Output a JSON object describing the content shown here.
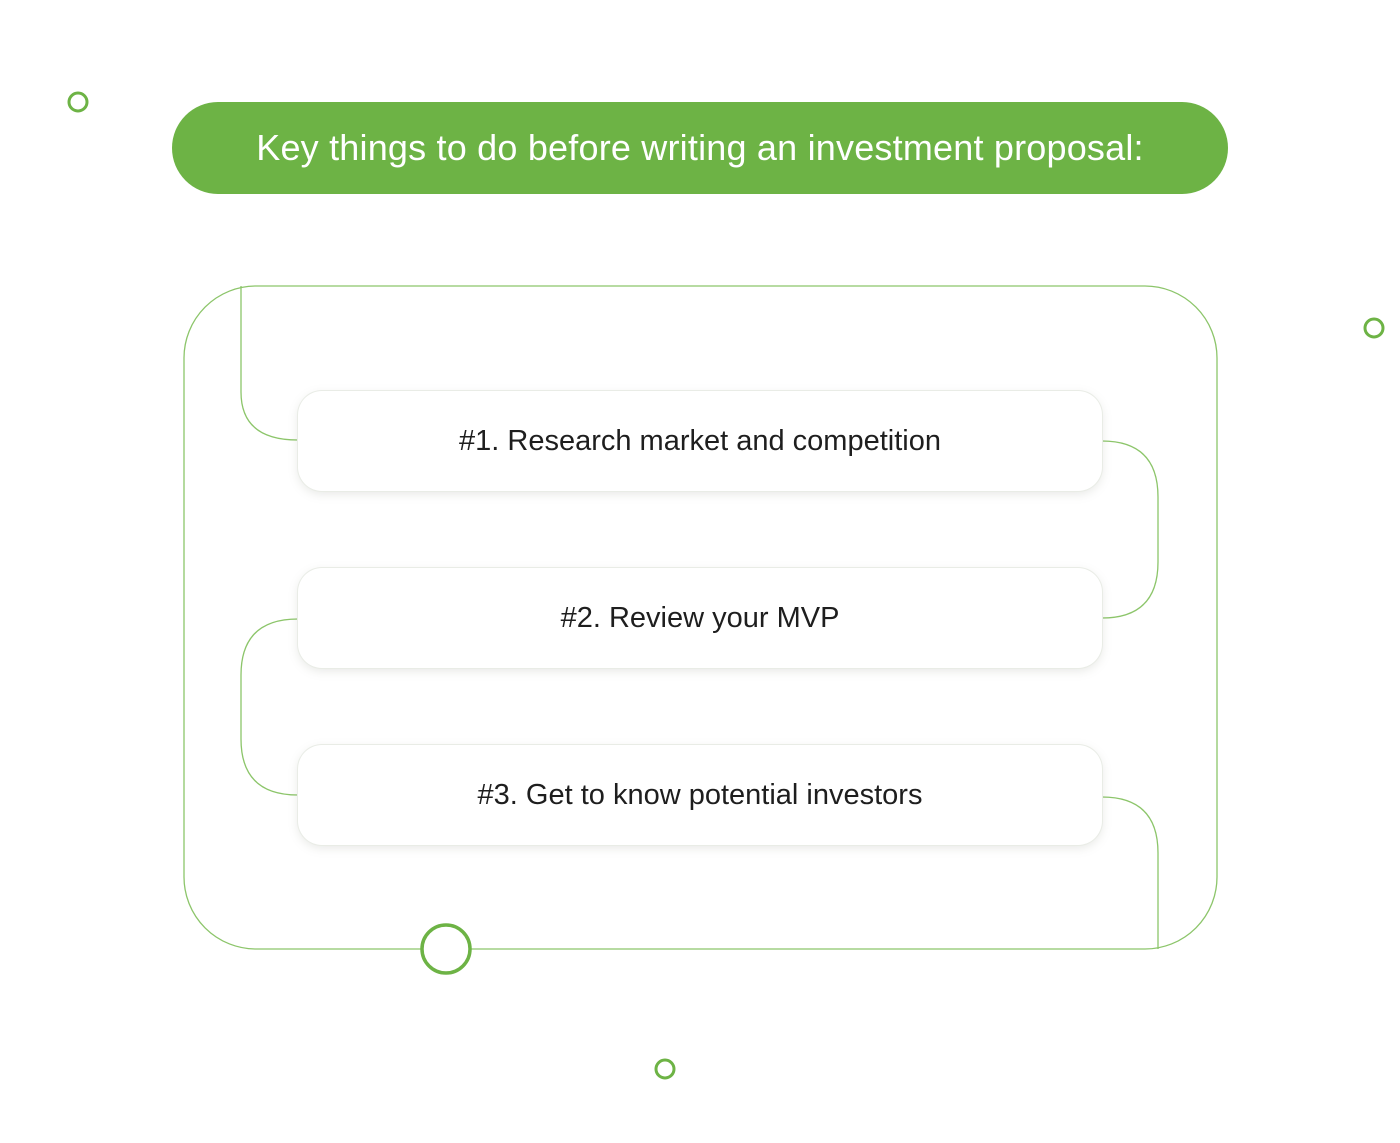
{
  "header": {
    "title": "Key things to do before writing an investment proposal:"
  },
  "steps": [
    {
      "label": "#1. Research market and competition"
    },
    {
      "label": "#2. Review your MVP"
    },
    {
      "label": "#3. Get to know potential investors"
    }
  ],
  "colors": {
    "accent": "#6db345",
    "text": "#1e1e1e",
    "card_background": "#ffffff",
    "page_background": "#ffffff"
  }
}
